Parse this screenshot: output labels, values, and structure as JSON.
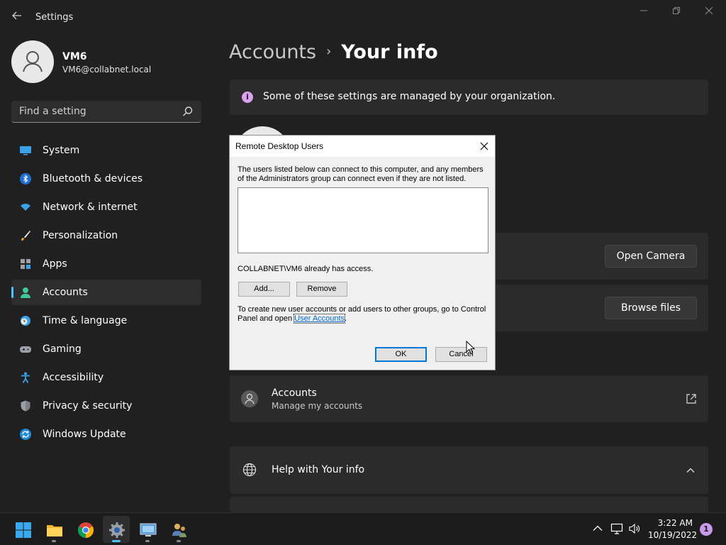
{
  "window": {
    "title": "Settings",
    "controls": [
      "minimize",
      "restore",
      "close"
    ]
  },
  "user": {
    "name": "VM6",
    "email": "VM6@collabnet.local"
  },
  "search": {
    "placeholder": "Find a setting"
  },
  "sidebar": {
    "items": [
      {
        "label": "System",
        "icon": "monitor-icon",
        "active": false
      },
      {
        "label": "Bluetooth & devices",
        "icon": "bluetooth-icon",
        "active": false
      },
      {
        "label": "Network & internet",
        "icon": "wifi-icon",
        "active": false
      },
      {
        "label": "Personalization",
        "icon": "brush-icon",
        "active": false
      },
      {
        "label": "Apps",
        "icon": "apps-icon",
        "active": false
      },
      {
        "label": "Accounts",
        "icon": "person-icon",
        "active": true
      },
      {
        "label": "Time & language",
        "icon": "clock-globe-icon",
        "active": false
      },
      {
        "label": "Gaming",
        "icon": "gamepad-icon",
        "active": false
      },
      {
        "label": "Accessibility",
        "icon": "accessibility-icon",
        "active": false
      },
      {
        "label": "Privacy & security",
        "icon": "shield-icon",
        "active": false
      },
      {
        "label": "Windows Update",
        "icon": "update-icon",
        "active": false
      }
    ]
  },
  "breadcrumb": {
    "parent": "Accounts",
    "separator": "›",
    "current": "Your info"
  },
  "main": {
    "org_notice": "Some of these settings are managed by your organization.",
    "open_camera_label": "Open Camera",
    "browse_files_label": "Browse files",
    "accounts_card": {
      "title": "Accounts",
      "subtitle": "Manage my accounts"
    },
    "help_card": {
      "title": "Help with Your info"
    }
  },
  "dialog": {
    "title": "Remote Desktop Users",
    "description": "The users listed below can connect to this computer, and any members of the Administrators group can connect even if they are not listed.",
    "access_note": "COLLABNET\\VM6 already has access.",
    "add_label": "Add...",
    "remove_label": "Remove",
    "help_text": "To create new user accounts or add users to other groups, go to Control Panel and open",
    "help_link": "User Accounts",
    "help_suffix": ".",
    "ok_label": "OK",
    "cancel_label": "Cancel"
  },
  "taskbar": {
    "apps": [
      "start-icon",
      "file-explorer-icon",
      "chrome-icon",
      "settings-icon",
      "remote-desktop-icon",
      "users-icon"
    ],
    "time": "3:22 AM",
    "date": "10/19/2022",
    "notification_count": "1"
  },
  "colors": {
    "background": "#202020",
    "card": "#2b2b2b",
    "accent": "#4cc2ff",
    "dialog_bg": "#f0f0f0"
  }
}
